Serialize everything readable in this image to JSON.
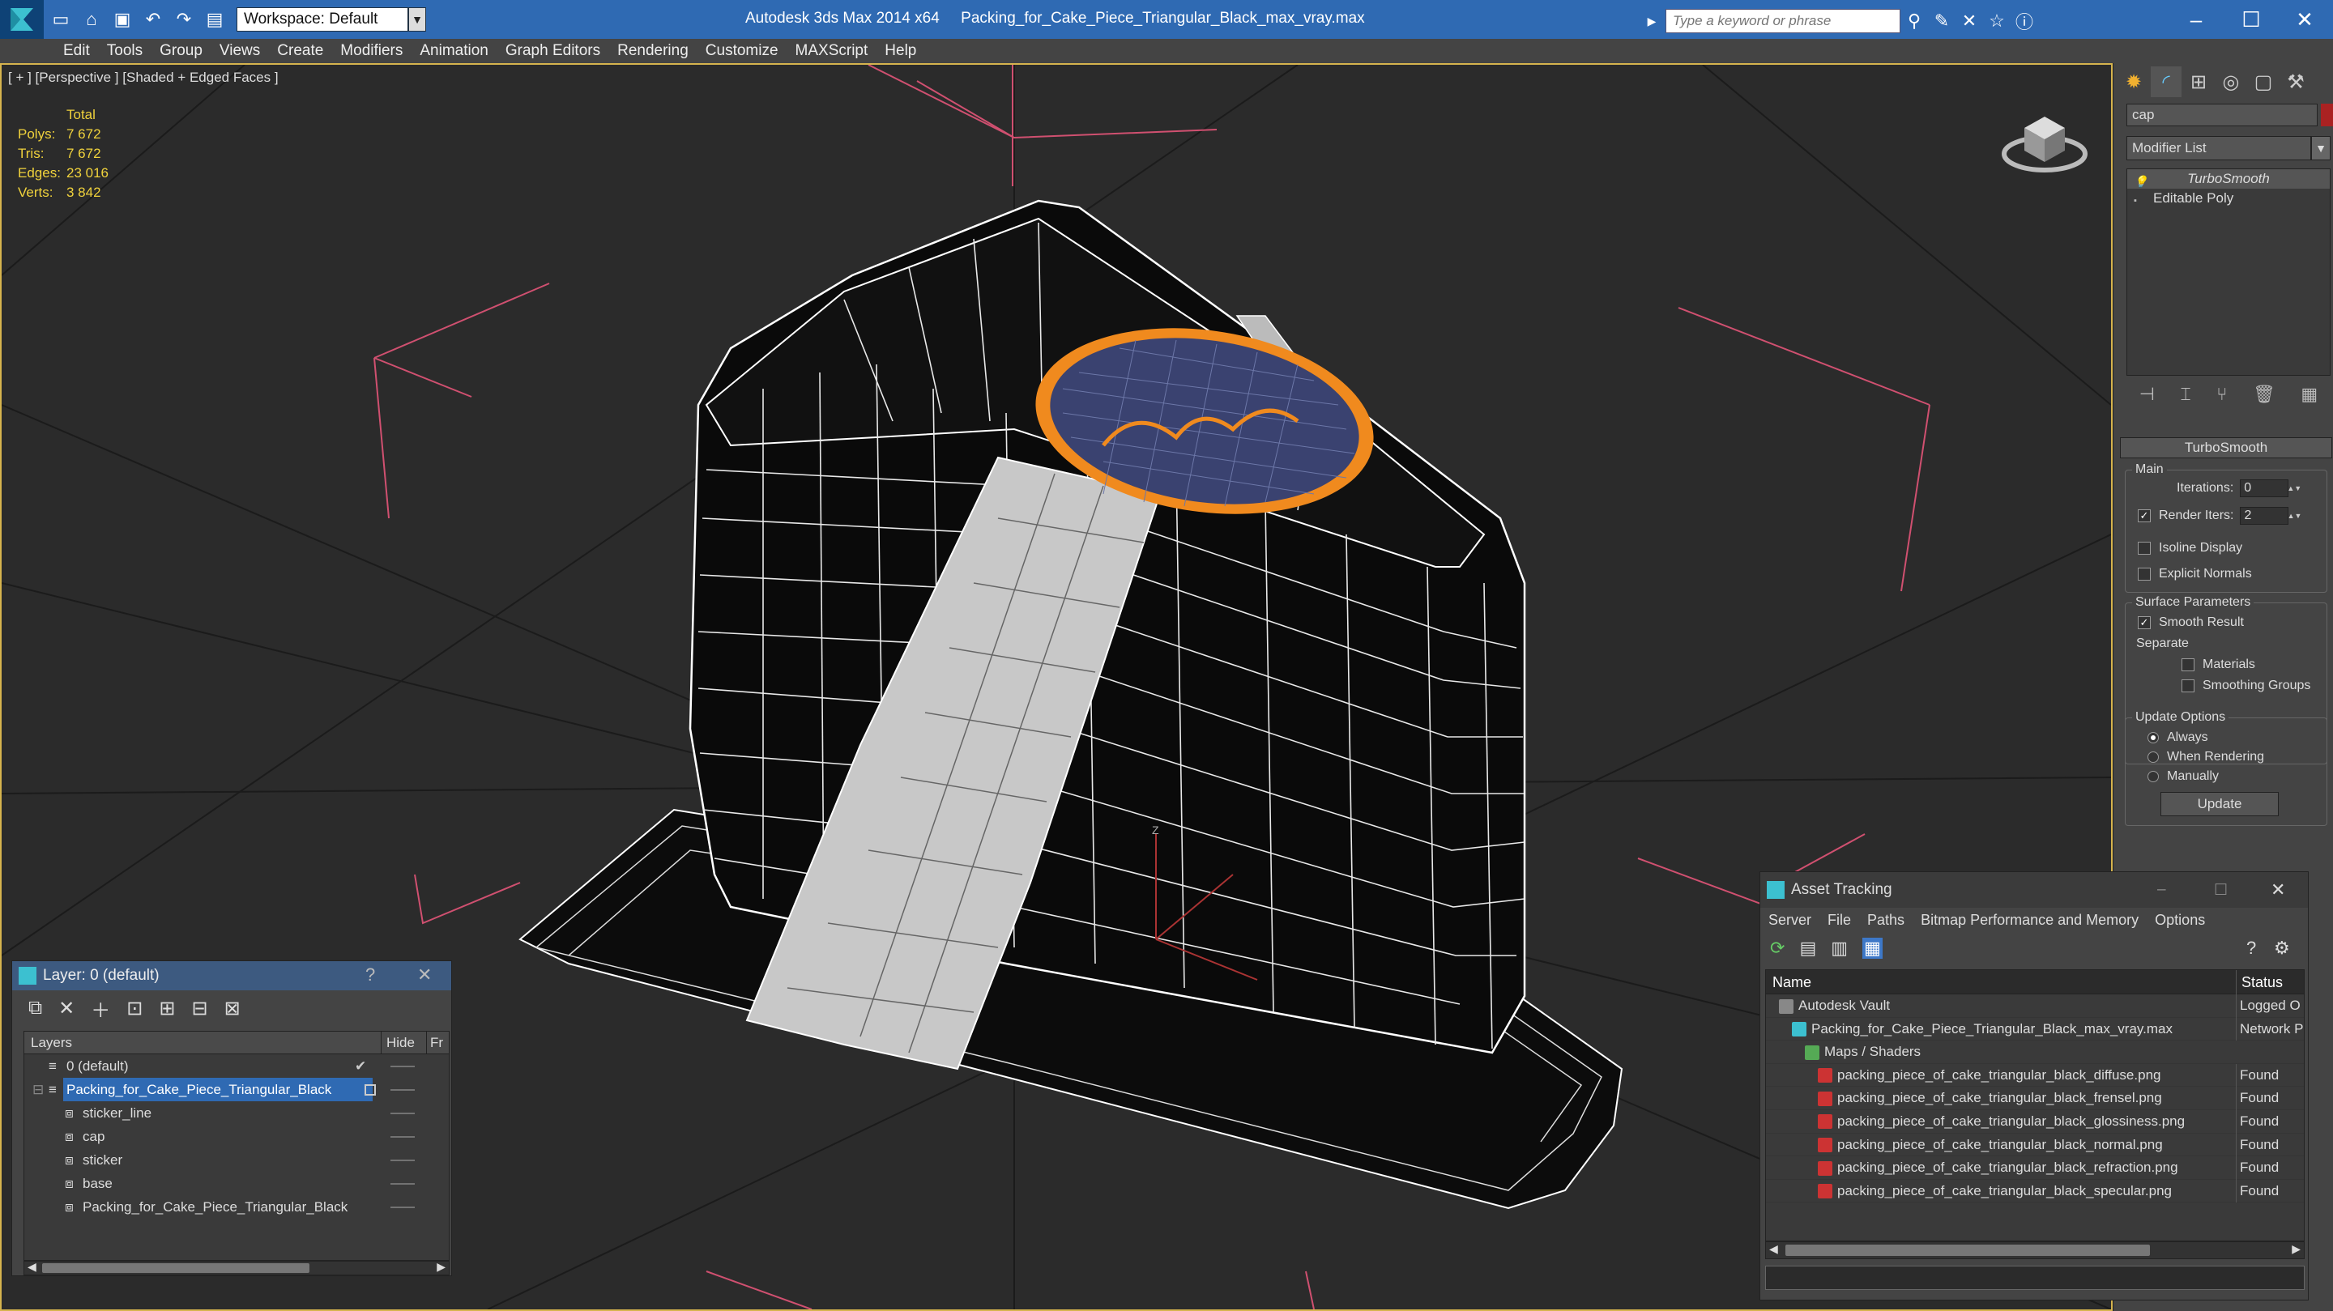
{
  "titlebar": {
    "app_title": "Autodesk 3ds Max  2014 x64",
    "file_name": "Packing_for_Cake_Piece_Triangular_Black_max_vray.max",
    "workspace": "Workspace: Default",
    "search_placeholder": "Type a keyword or phrase"
  },
  "menu": [
    "Edit",
    "Tools",
    "Group",
    "Views",
    "Create",
    "Modifiers",
    "Animation",
    "Graph Editors",
    "Rendering",
    "Customize",
    "MAXScript",
    "Help"
  ],
  "viewport": {
    "label": "[ + ] [Perspective ] [Shaded + Edged Faces ]",
    "stats": {
      "total_label": "Total",
      "polys_label": "Polys:",
      "polys": "7 672",
      "tris_label": "Tris:",
      "tris": "7 672",
      "edges_label": "Edges:",
      "edges": "23 016",
      "verts_label": "Verts:",
      "verts": "3 842"
    },
    "axis_label": "Z"
  },
  "command_panel": {
    "object_name": "cap",
    "modifier_list": "Modifier List",
    "stack": [
      "TurboSmooth",
      "Editable Poly"
    ],
    "rollout": "TurboSmooth",
    "main_group": "Main",
    "iterations_label": "Iterations:",
    "iterations": "0",
    "render_iters_label": "Render Iters:",
    "render_iters": "2",
    "isoline": "Isoline Display",
    "explicit": "Explicit Normals",
    "surface_group": "Surface Parameters",
    "smooth_result": "Smooth Result",
    "separate": "Separate",
    "materials": "Materials",
    "smoothing_groups": "Smoothing Groups",
    "update_group": "Update Options",
    "always": "Always",
    "when_rendering": "When Rendering",
    "manually": "Manually",
    "update_btn": "Update"
  },
  "layer_window": {
    "title": "Layer: 0 (default)",
    "help": "?",
    "col_layers": "Layers",
    "col_hide": "Hide",
    "col_f": "Fr",
    "rows": [
      {
        "name": "0 (default)",
        "indent": 0
      },
      {
        "name": "Packing_for_Cake_Piece_Triangular_Black",
        "indent": 0
      },
      {
        "name": "sticker_line",
        "indent": 1
      },
      {
        "name": "cap",
        "indent": 1
      },
      {
        "name": "sticker",
        "indent": 1
      },
      {
        "name": "base",
        "indent": 1
      },
      {
        "name": "Packing_for_Cake_Piece_Triangular_Black",
        "indent": 1
      }
    ]
  },
  "asset_tracking": {
    "title": "Asset Tracking",
    "menu": [
      "Server",
      "File",
      "Paths",
      "Bitmap Performance and Memory",
      "Options"
    ],
    "col_name": "Name",
    "col_status": "Status",
    "rows": [
      {
        "name": "Autodesk Vault",
        "status": "Logged O",
        "indent": 1,
        "icon": "vault"
      },
      {
        "name": "Packing_for_Cake_Piece_Triangular_Black_max_vray.max",
        "status": "Network P",
        "indent": 2,
        "icon": "max"
      },
      {
        "name": "Maps / Shaders",
        "status": "",
        "indent": 3,
        "icon": "maps"
      },
      {
        "name": "packing_piece_of_cake_triangular_black_diffuse.png",
        "status": "Found",
        "indent": 4,
        "icon": "png"
      },
      {
        "name": "packing_piece_of_cake_triangular_black_frensel.png",
        "status": "Found",
        "indent": 4,
        "icon": "png"
      },
      {
        "name": "packing_piece_of_cake_triangular_black_glossiness.png",
        "status": "Found",
        "indent": 4,
        "icon": "png"
      },
      {
        "name": "packing_piece_of_cake_triangular_black_normal.png",
        "status": "Found",
        "indent": 4,
        "icon": "png"
      },
      {
        "name": "packing_piece_of_cake_triangular_black_refraction.png",
        "status": "Found",
        "indent": 4,
        "icon": "png"
      },
      {
        "name": "packing_piece_of_cake_triangular_black_specular.png",
        "status": "Found",
        "indent": 4,
        "icon": "png"
      }
    ]
  },
  "colors": {
    "title_bar": "#2f6ab3",
    "viewport_border": "#d6b44e",
    "stats": "#f0d23c",
    "selection": "#2f6ab3",
    "sticker_outline": "#f08a1e"
  }
}
